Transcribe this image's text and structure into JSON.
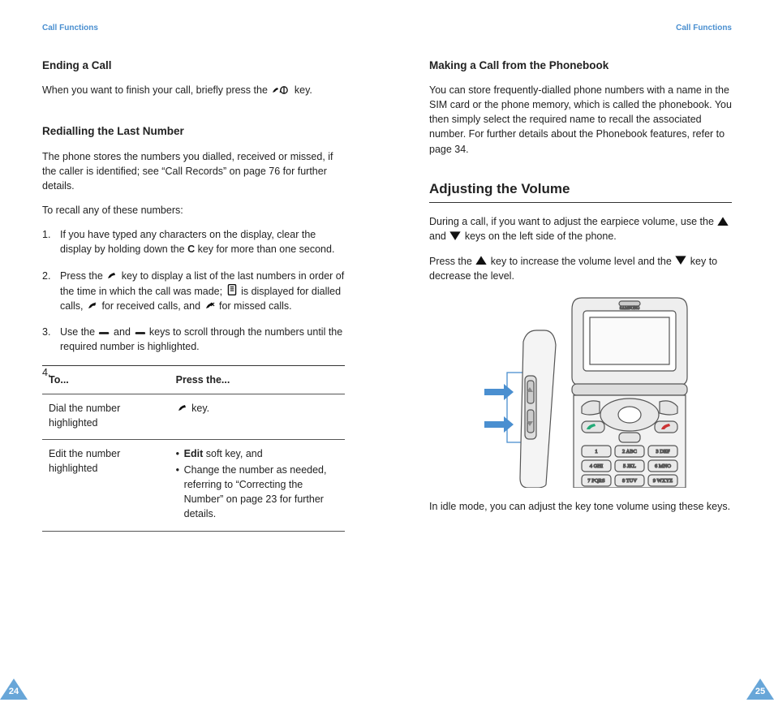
{
  "left": {
    "running": "Call Functions",
    "h_end": "Ending a Call",
    "p_end_a": "When you want to finish your call, briefly press the ",
    "p_end_b": " key.",
    "h_redial": "Redialling the Last Number",
    "p_redial_1": "The phone stores the numbers you dialled, received or missed, if the caller is identified; see “Call Records” on page 76 for further details.",
    "p_redial_2": "To recall any of these numbers:",
    "steps": {
      "s1_a": "If you have typed any characters on the display, clear the display by holding down the ",
      "s1_c": "C",
      "s1_b": " key for more than one second.",
      "s2_a": "Press the ",
      "s2_b": " key to display a list of the last numbers in order of the time in which the call was made; ",
      "s2_c": " is displayed for dialled calls, ",
      "s2_d": " for received calls, and ",
      "s2_e": " for missed calls.",
      "s3_a": "Use the ",
      "s3_b": " and ",
      "s3_c": " keys to scroll through the numbers until the required number is highlighted."
    },
    "table": {
      "th1": "To...",
      "th2": "Press the...",
      "r1c1": "Dial the number highlighted",
      "r1c2": " key.",
      "r2c1": "Edit the number highlighted",
      "r2c2_a_bold": "Edit",
      "r2c2_a_rest": " soft key, and",
      "r2c2_b": "Change the number as needed, referring to “Correcting the Number” on page 23 for further details."
    },
    "page": "24"
  },
  "right": {
    "running": "Call Functions",
    "h_pb": "Making a Call from the Phonebook",
    "p_pb": "You can store frequently-dialled phone numbers with a name in the SIM card or the phone memory, which is called the phonebook. You then simply select the required name to recall the associated number. For further details about the Phonebook features, refer to page 34.",
    "h_vol": "Adjusting the Volume",
    "p_vol_1a": "During a call, if you want to adjust the earpiece volume, use the ",
    "p_vol_1b": " and ",
    "p_vol_1c": " keys on the left side of the phone.",
    "p_vol_2a": "Press the ",
    "p_vol_2b": " key to increase the volume level and the ",
    "p_vol_2c": " key to decrease the level.",
    "p_vol_3": "In idle mode, you can adjust the key tone volume using these keys.",
    "page": "25"
  },
  "icons": {
    "end_call": "end-call-icon",
    "send": "send-key-icon",
    "dialled": "dialled-call-icon",
    "received": "received-call-icon",
    "missed": "missed-call-icon",
    "scroll_left": "scroll-left-icon",
    "scroll_right": "scroll-right-icon",
    "vol_up": "volume-up-icon",
    "vol_down": "volume-down-icon"
  }
}
